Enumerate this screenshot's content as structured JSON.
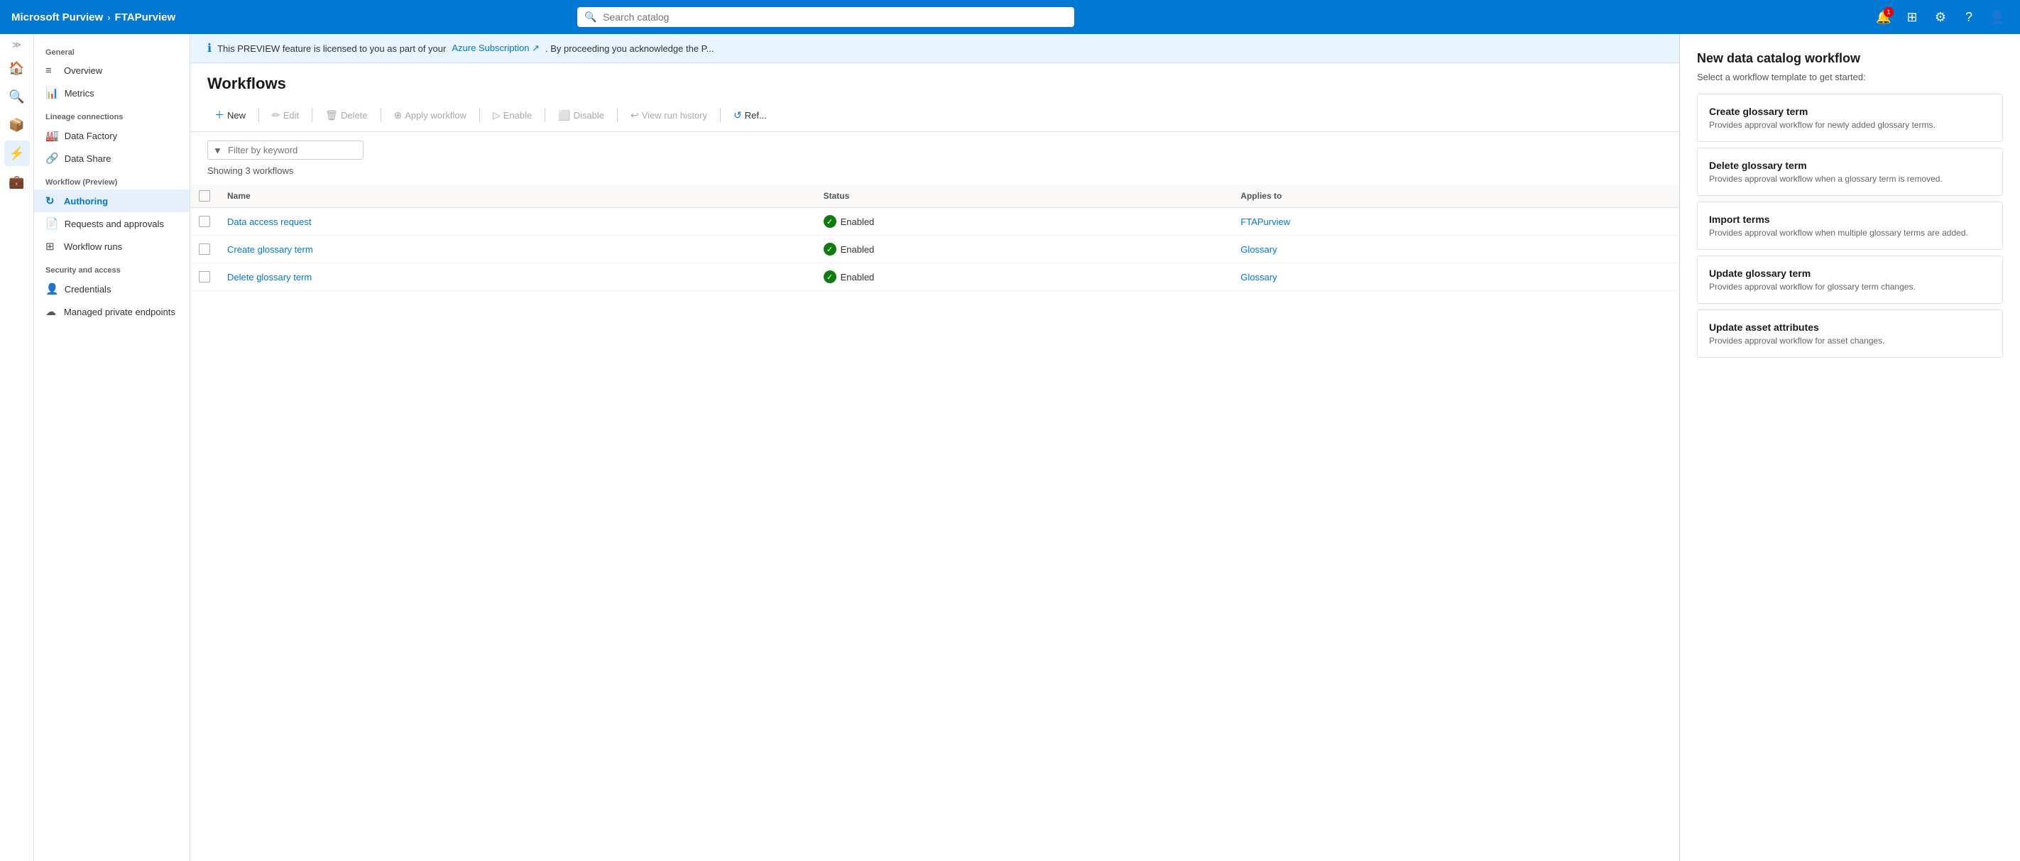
{
  "topnav": {
    "brand": "Microsoft Purview",
    "breadcrumb_sep": "›",
    "tenant": "FTAPurview",
    "search_placeholder": "Search catalog",
    "notification_badge": "1",
    "icons": [
      "notification-icon",
      "grid-icon",
      "settings-icon",
      "help-icon",
      "user-icon"
    ]
  },
  "sidebar": {
    "collapse_label": "«",
    "expand_label": "»",
    "general_label": "General",
    "items_general": [
      {
        "id": "overview",
        "label": "Overview",
        "icon": "≡"
      },
      {
        "id": "metrics",
        "label": "Metrics",
        "icon": "📊"
      }
    ],
    "lineage_label": "Lineage connections",
    "items_lineage": [
      {
        "id": "data-factory",
        "label": "Data Factory",
        "icon": "🏭"
      },
      {
        "id": "data-share",
        "label": "Data Share",
        "icon": "🔗"
      }
    ],
    "workflow_label": "Workflow (Preview)",
    "items_workflow": [
      {
        "id": "authoring",
        "label": "Authoring",
        "icon": "↻",
        "active": true
      },
      {
        "id": "requests-approvals",
        "label": "Requests and approvals",
        "icon": "📄"
      },
      {
        "id": "workflow-runs",
        "label": "Workflow runs",
        "icon": "⊞"
      }
    ],
    "security_label": "Security and access",
    "items_security": [
      {
        "id": "credentials",
        "label": "Credentials",
        "icon": "👤"
      },
      {
        "id": "managed-private",
        "label": "Managed private endpoints",
        "icon": "☁"
      }
    ]
  },
  "infobanner": {
    "icon": "ℹ",
    "text": "This PREVIEW feature is licensed to you as part of your",
    "link_text": "Azure Subscription ↗",
    "text2": ". By proceeding you acknowledge the P..."
  },
  "page": {
    "title": "Workflows"
  },
  "toolbar": {
    "new_label": "New",
    "edit_label": "Edit",
    "delete_label": "Delete",
    "apply_workflow_label": "Apply workflow",
    "enable_label": "Enable",
    "disable_label": "Disable",
    "view_run_history_label": "View run history",
    "refresh_label": "Ref..."
  },
  "filter": {
    "placeholder": "Filter by keyword",
    "showing_label": "Showing 3 workflows"
  },
  "table": {
    "col_name": "Name",
    "col_status": "Status",
    "col_applies": "Applies to",
    "rows": [
      {
        "name": "Data access request",
        "status": "Enabled",
        "applies_to": "FTAPurview"
      },
      {
        "name": "Create glossary term",
        "status": "Enabled",
        "applies_to": "Glossary"
      },
      {
        "name": "Delete glossary term",
        "status": "Enabled",
        "applies_to": "Glossary"
      }
    ]
  },
  "right_panel": {
    "title": "New data catalog workflow",
    "subtitle": "Select a workflow template to get started:",
    "templates": [
      {
        "id": "create-glossary-term",
        "title": "Create glossary term",
        "desc": "Provides approval workflow for newly added glossary terms."
      },
      {
        "id": "delete-glossary-term",
        "title": "Delete glossary term",
        "desc": "Provides approval workflow when a glossary term is removed."
      },
      {
        "id": "import-terms",
        "title": "Import terms",
        "desc": "Provides approval workflow when multiple glossary terms are added."
      },
      {
        "id": "update-glossary-term",
        "title": "Update glossary term",
        "desc": "Provides approval workflow for glossary term changes."
      },
      {
        "id": "update-asset-attributes",
        "title": "Update asset attributes",
        "desc": "Provides approval workflow for asset changes."
      }
    ]
  }
}
